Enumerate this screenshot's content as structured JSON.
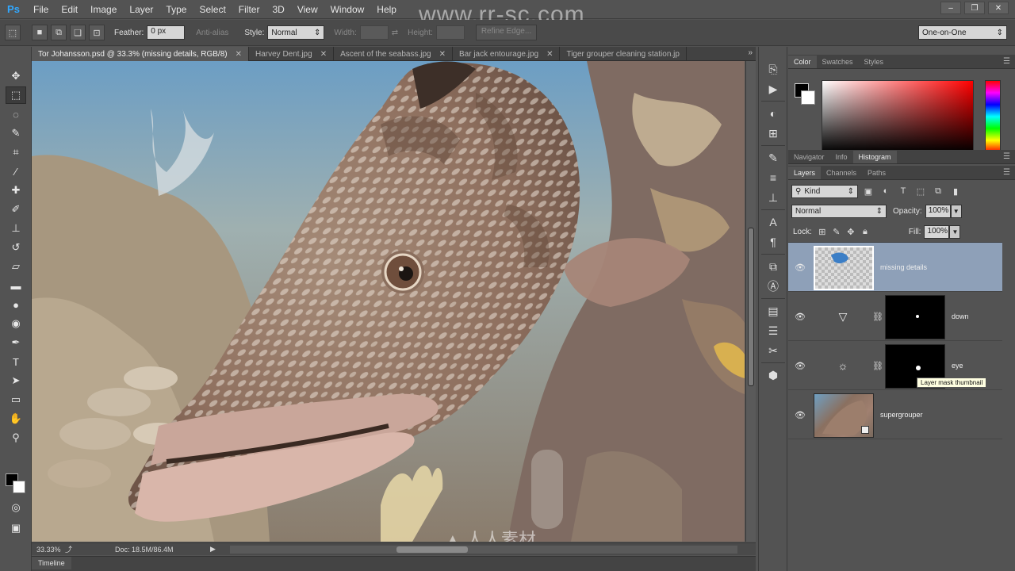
{
  "menubar": {
    "logo": "Ps",
    "items": [
      "File",
      "Edit",
      "Image",
      "Layer",
      "Type",
      "Select",
      "Filter",
      "3D",
      "View",
      "Window",
      "Help"
    ],
    "window_controls": [
      "‒",
      "❐",
      "✕"
    ]
  },
  "options": {
    "feather_label": "Feather:",
    "feather_value": "0 px",
    "antialias_label": "Anti-alias",
    "style_label": "Style:",
    "style_value": "Normal",
    "width_label": "Width:",
    "height_label": "Height:",
    "refine_edge": "Refine Edge...",
    "workspace": "One-on-One"
  },
  "watermark_top": "www.rr-sc.com",
  "doc_tabs": [
    {
      "label": "Tor Johansson.psd @ 33.3% (missing details, RGB/8)",
      "active": true
    },
    {
      "label": "Harvey Dent.jpg"
    },
    {
      "label": "Ascent of the seabass.jpg"
    },
    {
      "label": "Bar jack entourage.jpg"
    },
    {
      "label": "Tiger grouper cleaning station.jp"
    }
  ],
  "status": {
    "zoom": "33.33%",
    "doc_size": "Doc: 18.5M/86.4M"
  },
  "timeline": {
    "label": "Timeline"
  },
  "color_panel": {
    "tabs": [
      "Color",
      "Swatches",
      "Styles"
    ],
    "fg_color": "#000000",
    "bg_color": "#ffffff"
  },
  "nav_panel": {
    "tabs": [
      "Navigator",
      "Info",
      "Histogram"
    ]
  },
  "layers_panel": {
    "tabs": [
      "Layers",
      "Channels",
      "Paths"
    ],
    "kind_label": "Kind",
    "blend_mode": "Normal",
    "opacity_label": "Opacity:",
    "opacity_value": "100%",
    "lock_label": "Lock:",
    "fill_label": "Fill:",
    "fill_value": "100%",
    "layers": [
      {
        "name": "missing details",
        "selected": true
      },
      {
        "name": "down",
        "adjustment": "levels"
      },
      {
        "name": "eye",
        "adjustment": "brightness"
      },
      {
        "name": "supergrouper"
      }
    ],
    "tooltip": "Layer mask thumbnail"
  }
}
